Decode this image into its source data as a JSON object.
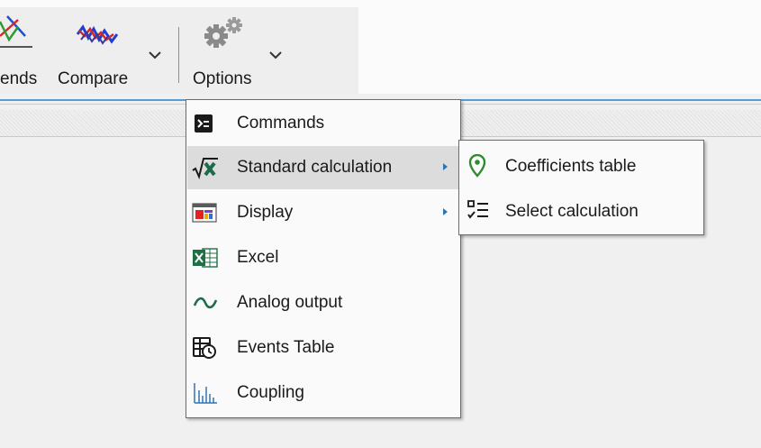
{
  "ribbon": {
    "buttons": [
      {
        "id": "trends",
        "label": "ends",
        "icon": "trends-icon"
      },
      {
        "id": "compare",
        "label": "Compare",
        "icon": "compare-icon"
      },
      {
        "id": "options",
        "label": "Options",
        "icon": "gears-icon"
      }
    ]
  },
  "options_menu": {
    "items": [
      {
        "label": "Commands",
        "icon": "terminal-icon",
        "has_submenu": false
      },
      {
        "label": "Standard calculation",
        "icon": "sqrt-calculation-icon",
        "has_submenu": true,
        "highlighted": true
      },
      {
        "label": "Display",
        "icon": "display-window-icon",
        "has_submenu": true
      },
      {
        "label": "Excel",
        "icon": "excel-icon",
        "has_submenu": false
      },
      {
        "label": "Analog output",
        "icon": "wave-icon",
        "has_submenu": false
      },
      {
        "label": "Events Table",
        "icon": "events-table-icon",
        "has_submenu": false
      },
      {
        "label": "Coupling",
        "icon": "coupling-bars-icon",
        "has_submenu": false
      }
    ]
  },
  "standard_calculation_submenu": {
    "items": [
      {
        "label": "Coefficients table",
        "icon": "location-pin-icon"
      },
      {
        "label": "Select calculation",
        "icon": "checklist-icon"
      }
    ]
  },
  "colors": {
    "accent_blue": "#2e75b6",
    "separator_blue": "#5b9bd5",
    "hover_gray": "#dcdcdc",
    "excel_green": "#1d7044",
    "pin_green": "#2e8b2e"
  }
}
